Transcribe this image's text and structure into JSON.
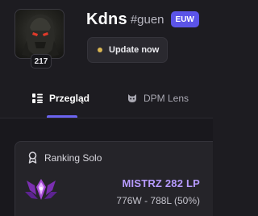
{
  "profile": {
    "level": "217",
    "summoner_name": "Kdns",
    "tagline": "#guen",
    "region": "EUW",
    "update_label": "Update now",
    "status_color": "#d9b552",
    "avatar_icon": "dark-champion-portrait"
  },
  "tabs": [
    {
      "label": "Przegląd",
      "icon": "overview-list-icon",
      "active": true
    },
    {
      "label": "DPM Lens",
      "icon": "cat-lens-icon",
      "active": false
    }
  ],
  "ranked": {
    "queue_label": "Ranking Solo",
    "tier": "MISTRZ 282 LP",
    "record": "776W - 788L (50%)",
    "emblem": "master-emblem-icon",
    "accent": "#b79bff"
  },
  "colors": {
    "brand": "#5b54e8",
    "tab_underline": "#6b64f0"
  }
}
